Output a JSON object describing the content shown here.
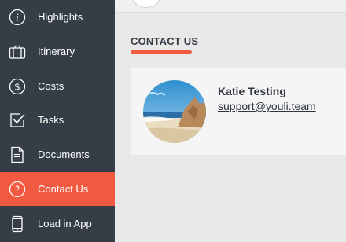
{
  "sidebar": {
    "items": [
      {
        "label": "Highlights",
        "icon": "info-icon",
        "active": false
      },
      {
        "label": "Itinerary",
        "icon": "suitcase-icon",
        "active": false
      },
      {
        "label": "Costs",
        "icon": "dollar-icon",
        "active": false
      },
      {
        "label": "Tasks",
        "icon": "checkbox-icon",
        "active": false
      },
      {
        "label": "Documents",
        "icon": "document-icon",
        "active": false
      },
      {
        "label": "Contact Us",
        "icon": "question-icon",
        "active": true
      },
      {
        "label": "Load in App",
        "icon": "phone-icon",
        "active": false
      }
    ]
  },
  "main": {
    "section_title": "CONTACT US",
    "contact": {
      "name": "Katie Testing",
      "email": "support@youli.team",
      "photo": "beach-photo"
    }
  },
  "colors": {
    "sidebar_bg": "#353e47",
    "accent": "#f15a40",
    "page_bg": "#e8e8e8",
    "card_bg": "#f5f5f5",
    "text_dark": "#2f363d"
  }
}
